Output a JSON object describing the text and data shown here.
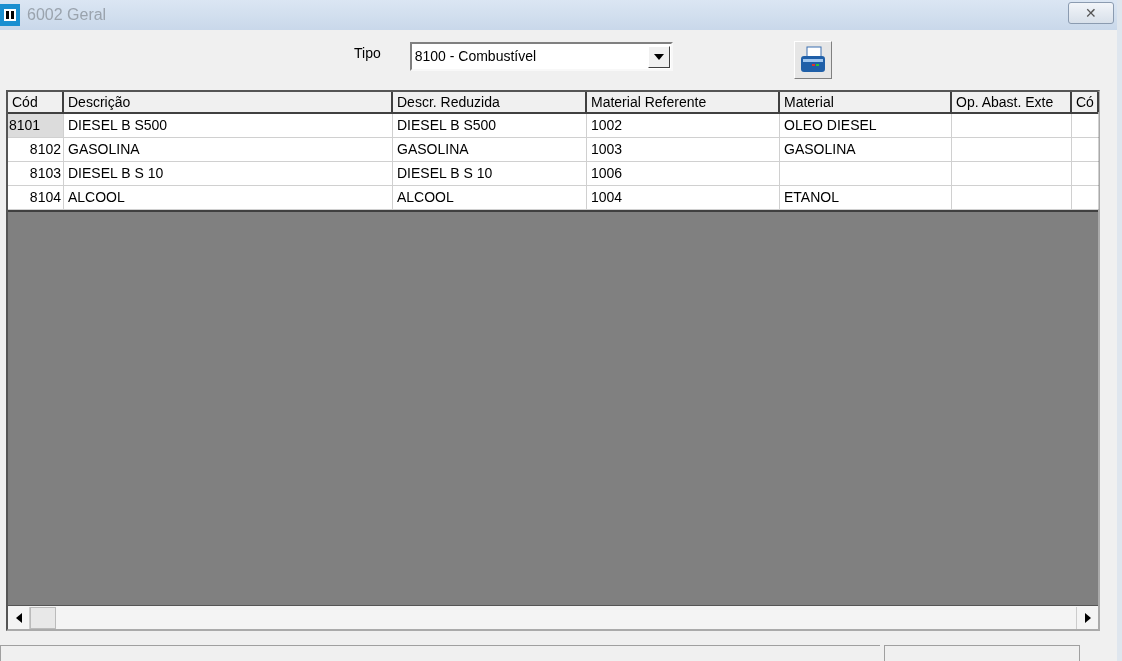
{
  "window": {
    "title": "6002 Geral",
    "close": "✕"
  },
  "filter": {
    "label": "Tipo",
    "value": "8100 - Combustível"
  },
  "table": {
    "columns": [
      "Cód",
      "Descrição",
      "Descr. Reduzida",
      "Material Referente",
      "Material",
      "Op. Abast. Exte",
      "Có"
    ],
    "rows": [
      {
        "selected": true,
        "cod": "8101",
        "descricao": "DIESEL B S500",
        "descr_reduzida": "DIESEL B S500",
        "material_referente": "1002",
        "material": "OLEO DIESEL"
      },
      {
        "selected": false,
        "cod": "8102",
        "descricao": "GASOLINA",
        "descr_reduzida": "GASOLINA",
        "material_referente": "1003",
        "material": "GASOLINA"
      },
      {
        "selected": false,
        "cod": "8103",
        "descricao": "DIESEL B S 10",
        "descr_reduzida": "DIESEL B S 10",
        "material_referente": "1006"
      },
      {
        "selected": false,
        "cod": "8104",
        "descricao": "ALCOOL",
        "descr_reduzida": "ALCOOL",
        "material_referente": "1004",
        "material": "ETANOL"
      }
    ]
  }
}
